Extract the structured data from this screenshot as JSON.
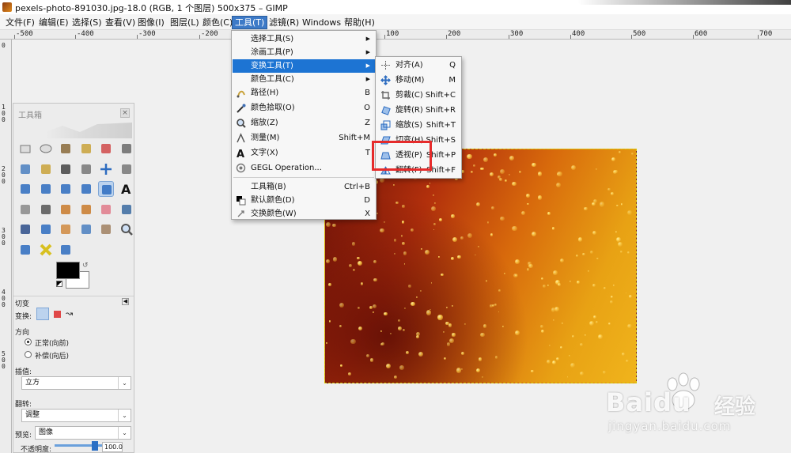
{
  "window": {
    "title": "pexels-photo-891030.jpg-18.0 (RGB, 1 个图层) 500x375 – GIMP"
  },
  "menubar": {
    "items": [
      "文件(F)",
      "编辑(E)",
      "选择(S)",
      "查看(V)",
      "图像(I)",
      "图层(L)",
      "颜色(C)",
      "工具(T)",
      "滤镜(R)",
      "Windows",
      "帮助(H)"
    ],
    "active": "工具(T)"
  },
  "ruler": {
    "h_labels": [
      "-500",
      "-400",
      "-300",
      "-200",
      "-100",
      "0",
      "100",
      "200",
      "300",
      "400",
      "500",
      "600",
      "700"
    ],
    "v_labels": [
      "0",
      "100",
      "200",
      "300",
      "400",
      "500"
    ]
  },
  "tools_menu": {
    "items": [
      {
        "label": "选择工具(S)",
        "shortcut": "",
        "submenu": true,
        "icon": "none"
      },
      {
        "label": "涂画工具(P)",
        "shortcut": "",
        "submenu": true,
        "icon": "none"
      },
      {
        "label": "变换工具(T)",
        "shortcut": "",
        "submenu": true,
        "icon": "none",
        "highlighted": true
      },
      {
        "label": "颜色工具(C)",
        "shortcut": "",
        "submenu": true,
        "icon": "none"
      },
      {
        "label": "路径(H)",
        "shortcut": "B",
        "icon": "path-icon"
      },
      {
        "label": "颜色拾取(O)",
        "shortcut": "O",
        "icon": "color-picker-icon"
      },
      {
        "label": "缩放(Z)",
        "shortcut": "Z",
        "icon": "zoom-icon"
      },
      {
        "label": "测量(M)",
        "shortcut": "Shift+M",
        "icon": "measure-icon"
      },
      {
        "label": "文字(X)",
        "shortcut": "T",
        "icon": "text-icon"
      },
      {
        "label": "GEGL Operation...",
        "shortcut": "",
        "icon": "gegl-icon"
      },
      {
        "label": "工具箱(B)",
        "shortcut": "Ctrl+B",
        "icon": "none"
      },
      {
        "label": "默认颜色(D)",
        "shortcut": "D",
        "icon": "default-colors-icon"
      },
      {
        "label": "交换颜色(W)",
        "shortcut": "X",
        "icon": "swap-colors-icon"
      }
    ]
  },
  "transform_menu": {
    "items": [
      {
        "label": "对齐(A)",
        "shortcut": "Q",
        "icon": "align-icon"
      },
      {
        "label": "移动(M)",
        "shortcut": "M",
        "icon": "move-icon"
      },
      {
        "label": "剪裁(C)",
        "shortcut": "Shift+C",
        "icon": "crop-icon"
      },
      {
        "label": "旋转(R)",
        "shortcut": "Shift+R",
        "icon": "rotate-icon"
      },
      {
        "label": "缩放(S)",
        "shortcut": "Shift+T",
        "icon": "scale-icon"
      },
      {
        "label": "切变(H)",
        "shortcut": "Shift+S",
        "icon": "shear-icon"
      },
      {
        "label": "透视(P)",
        "shortcut": "Shift+P",
        "icon": "perspective-icon",
        "highlighted": true
      },
      {
        "label": "翻转(F)",
        "shortcut": "Shift+F",
        "icon": "flip-icon"
      }
    ]
  },
  "toolbox": {
    "title": "工具箱",
    "close": "×",
    "options": {
      "heading": "切变",
      "transform_label": "变换:",
      "direction_label": "方向",
      "direction_forward": "正常(向前)",
      "direction_backward": "补偿(向后)",
      "interp_label": "插值:",
      "interp_value": "立方",
      "clip_label": "翻转:",
      "clip_value": "调整",
      "preview_label": "预览:",
      "preview_value": "图像",
      "opacity_label": "不透明度:",
      "opacity_value": "100.0",
      "opacity_fraction": 1.0
    }
  },
  "watermark": {
    "brand": "Baidu",
    "brand2": "经验",
    "url": "jingyan.baidu.com"
  }
}
